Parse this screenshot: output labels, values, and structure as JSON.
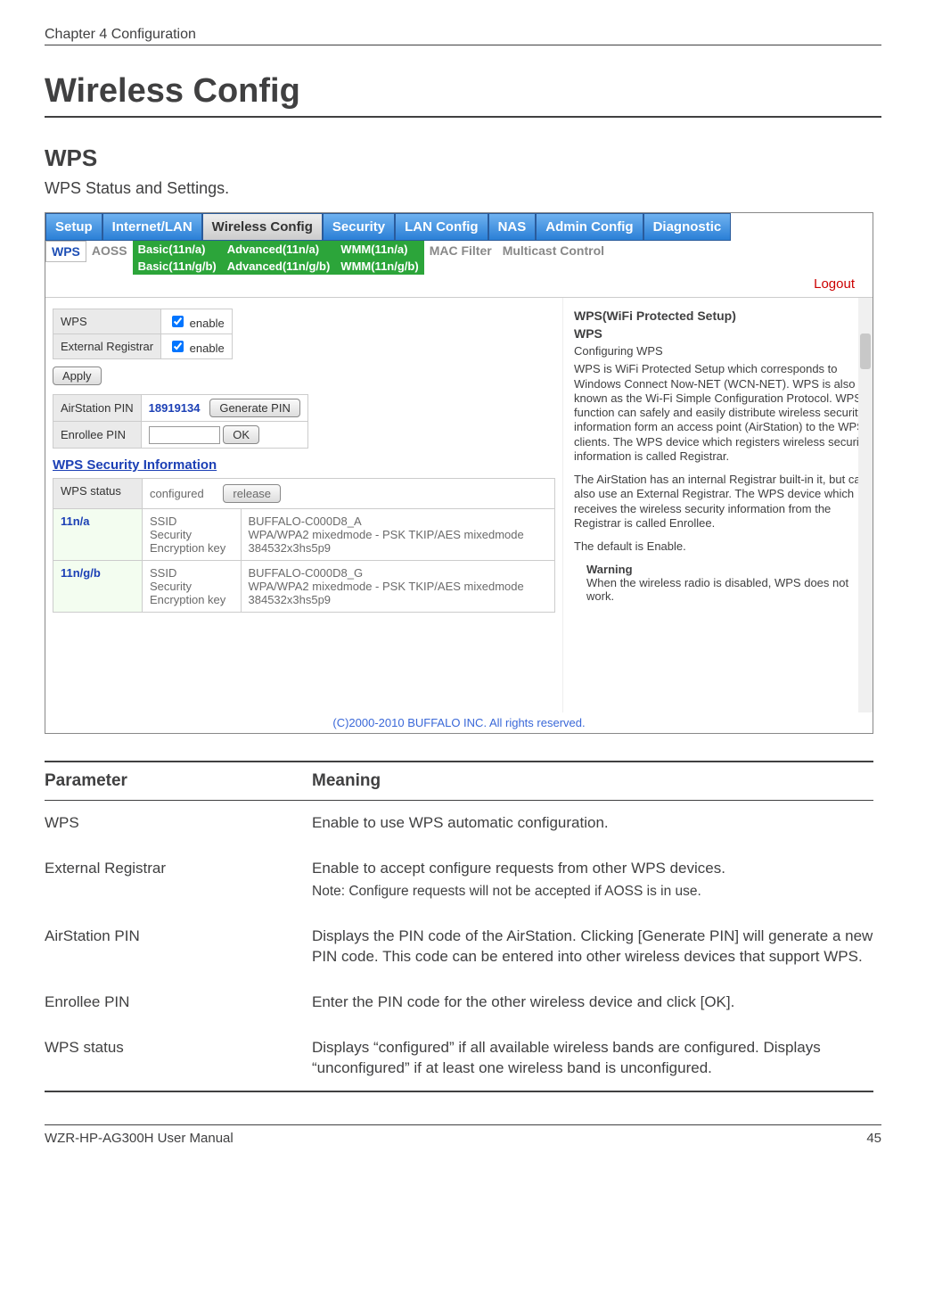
{
  "header": {
    "chapter": "Chapter 4  Configuration"
  },
  "title": "Wireless Config",
  "section": {
    "title": "WPS",
    "subtitle": "WPS Status and Settings."
  },
  "screenshot": {
    "topnav": {
      "tabs": [
        "Setup",
        "Internet/LAN",
        "Wireless Config",
        "Security",
        "LAN Config",
        "NAS",
        "Admin Config",
        "Diagnostic"
      ],
      "active_index": 2
    },
    "subnav": {
      "wps": "WPS",
      "aoss": "AOSS",
      "basic_a": "Basic(11n/a)",
      "basic_gb": "Basic(11n/g/b)",
      "adv_a": "Advanced(11n/a)",
      "adv_gb": "Advanced(11n/g/b)",
      "wmm_a": "WMM(11n/a)",
      "wmm_gb": "WMM(11n/g/b)",
      "macfilter": "MAC Filter",
      "multicast": "Multicast Control"
    },
    "logout": "Logout",
    "config": {
      "wps_label": "WPS",
      "extreg_label": "External Registrar",
      "enable": "enable",
      "apply": "Apply",
      "airpin_label": "AirStation PIN",
      "airpin_value": "18919134",
      "genpin": "Generate PIN",
      "enrolpin_label": "Enrollee PIN",
      "ok": "OK"
    },
    "secinfo_header": "WPS Security Information",
    "info": {
      "status_label": "WPS status",
      "status_value": "configured",
      "release": "release",
      "band_a": "11n/a",
      "band_gb": "11n/g/b",
      "ssid_lbl": "SSID",
      "sec_lbl": "Security",
      "key_lbl": "Encryption key",
      "ssid_a": "BUFFALO-C000D8_A",
      "sec_a": "WPA/WPA2 mixedmode - PSK TKIP/AES mixedmode",
      "key_a": "384532x3hs5p9",
      "ssid_gb": "BUFFALO-C000D8_G",
      "sec_gb": "WPA/WPA2 mixedmode - PSK TKIP/AES mixedmode",
      "key_gb": "384532x3hs5p9"
    },
    "help": {
      "h1": "WPS(WiFi Protected Setup)",
      "h2": "WPS",
      "p1": "Configuring WPS",
      "p2": "WPS is WiFi Protected Setup which corresponds to Windows Connect Now-NET (WCN-NET). WPS is also known as the Wi-Fi Simple Configuration Protocol. WPS function can safely and easily distribute wireless security information form an access point (AirStation) to the WPS clients. The WPS device which registers wireless security information is called Registrar.",
      "p3": "The AirStation has an internal Registrar built-in it, but can also use an External Registrar. The WPS device which receives the wireless security information from the Registrar is called Enrollee.",
      "p4": "The default is Enable.",
      "warn_h": "Warning",
      "warn_p": "When the wireless radio is disabled, WPS does not work."
    },
    "copyright": "(C)2000-2010 BUFFALO INC. All rights reserved."
  },
  "paramtable": {
    "headers": {
      "param": "Parameter",
      "meaning": "Meaning"
    },
    "rows": [
      {
        "param": "WPS",
        "meaning": "Enable to use WPS automatic configuration."
      },
      {
        "param": "External Registrar",
        "meaning": "Enable to accept configure requests from other WPS devices.",
        "note": "Note:  Configure requests will not be accepted if AOSS is in use."
      },
      {
        "param": "AirStation PIN",
        "meaning": "Displays the PIN code of the AirStation. Clicking [Generate PIN] will generate a new PIN code. This code can be entered into other wireless devices that support WPS."
      },
      {
        "param": "Enrollee PIN",
        "meaning": "Enter the PIN code for the other wireless device and click [OK]."
      },
      {
        "param": "WPS status",
        "meaning": "Displays “configured” if all available wireless bands are configured.  Displays “unconfigured” if at least one wireless band is unconfigured."
      }
    ]
  },
  "footer": {
    "manual": "WZR-HP-AG300H User Manual",
    "page": "45"
  }
}
